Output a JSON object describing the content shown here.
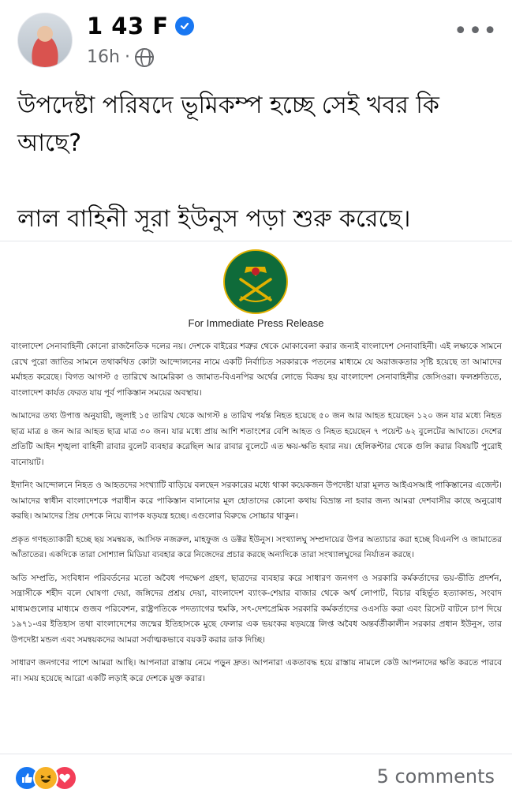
{
  "post": {
    "author": "1 43 F",
    "time": "16h",
    "separator": "·",
    "more_label": "•••",
    "text_line1": "উপদেষ্টা পরিষদে ভূমিকম্প হচ্ছে সেই খবর কি আছে?",
    "text_line2": "লাল বাহিনী সূরা ইউনুস পড়া শুরু করেছে।"
  },
  "release": {
    "title": "For Immediate Press Release",
    "paragraphs": [
      "বাংলাদেশ সেনাবাহিনী কোনো রাজনৈতিক দলের নয়। দেশকে বাইরের শত্রুর থেকে মোকাবেলা করার জন্যই বাংলাদেশ সেনাবাহিনী। এই লক্ষ্যকে সামনে রেখে পুরো জাতির সামনে তথাকথিত কোটা আন্দোলনের নামে একটি নির্বাচিত সরকারকে পতনের মাধ্যমে যে অরাজকতার সৃষ্টি হয়েছে তা আমাদের মর্মাহত করেছে। বিগত আগস্ট ৫ তারিখে আমেরিকা ও জামাত-বিএনপির অর্থের লোভে বিক্রয় হয় বাংলাদেশ সেনাবাহিনীর জেসিওরা। ফলশ্রুতিতে, বাংলাদেশ কার্যত ফেরত যায় পূর্ব পাকিস্তান সময়ের অবস্থায়।",
      "আমাদের তথ্য উপাত্ত অনুযায়ী, জুলাই ১৫ তারিখ থেকে আগস্ট ৪ তারিখ পর্যন্ত নিহত হয়েছে ৫০ জন আর আহত হয়েছেন ১২০ জন যার মধ্যে নিহত ছাত্র মাত্র ৪ জন আর আহত ছাত্র মাত্র ৩০ জন। যার মধ্যে প্রায় আশি শতাংশের বেশি আহত ও নিহত হয়েছেন ৭ পয়েন্ট ৬২ বুলেটের আঘাতে। দেশের প্রতিটি আইন শৃঙ্খলা বাহিনী রাবার বুলেট ব্যবহার করেছিল আর রাবার বুলেটে এত ক্ষয়-ক্ষতি হবার নয়। হেলিকপ্টার থেকে গুলি করার বিষয়টি পুরোই বানোয়াট।",
      "ইদানিং আন্দোলনে নিহত ও আহতদের সংখ্যাটি বাড়িয়ে বলছেন সরকারের মধ্যে থাকা কয়েকজন উপদেষ্টা যারা মূলত আইএসআই পাকিস্তানের এজেন্ট। আমাদের স্বাধীন বাংলাদেশকে পরাধীন করে পাকিস্তান বানানোর মূল হোতাদের কোনো কথায় বিভ্রান্ত না হবার জন্য আমরা দেশবাসীর কাছে অনুরোধ করছি। আমাদের প্রিয় দেশকে নিয়ে ব্যাপক ষড়যন্ত্র হচ্ছে। এগুলোর বিরুদ্ধে সোচ্চার থাকুন।",
      "প্রকৃত গণহত্যাকারী হচ্ছে ছয় সমন্বয়ক, আসিফ নজরুল, মাহফুজ ও ডক্টর ইউনুস। সংখ্যালঘু সম্প্রদায়ের উপর অত্যাচার করা হচ্ছে বিএনপি ও জামাতের আঁতাতের। একদিকে তারা সোশ্যাল মিডিয়া ব্যবহার করে নিজেদের প্রচার করছে অন্যদিকে তারা সংখ্যালঘুদের নির্যাতন করছে।",
      "অতি সম্প্রতি, সংবিধান পরিবর্তনের মতো অবৈধ পদক্ষেপ গ্রহণ, ছাত্রদের ব্যবহার করে সাধারণ জনগণ ও সরকারি কর্মকর্তাদের ভয়-ভীতি প্রদর্শন, সন্ত্রাসীকে শহীদ বলে ঘোষণা দেয়া, জঙ্গিদের প্রশ্রয় দেয়া, বাংলাদেশ ব্যাংক-শেয়ার বাজার থেকে অর্থ লোপাট, বিচার বহির্ভূত হত্যাকান্ড, সংবাদ মাধ্যমগুলোর মাধ্যমে গুজব পরিবেশন, রাষ্ট্রপতিকে পদত্যাগের হুমকি, সৎ-দেশপ্রেমিক সরকারি কর্মকর্তাদের ওএসডি করা এবং রিসেট বাটনে চাপ দিয়ে ১৯৭১-এর ইতিহাস তথা বাংলাদেশের জন্মের ইতিহাসকে মুছে ফেলার এক ভয়ংকর ষড়যন্ত্রে লিপ্ত অবৈধ অন্তর্বর্তীকালীন সরকার প্রধান ইউনুস, তার উপদেষ্টা মন্ডল এবং সমন্বয়কদের আমরা সর্বাত্মকভাবে বয়কট করার ডাক দিচ্ছি।",
      "সাধারণ জনগণের পাশে আমরা আছি। আপনারা রাস্তায় নেমে পড়ুন দ্রুত। আপনারা একতাবদ্ধ হয়ে রাস্তায় নামলে কেউ আপনাদের ক্ষতি করতে পারবে না। সময় হয়েছে আরো একটি লড়াই করে দেশকে মুক্ত করার।"
    ]
  },
  "footer": {
    "comments": "5 comments",
    "reactions": [
      "like-icon",
      "haha-icon",
      "love-icon"
    ]
  },
  "colors": {
    "accent": "#1877f2",
    "meta": "#65676b",
    "emblem_green": "#0f6b3a",
    "emblem_gold": "#e2b100"
  }
}
